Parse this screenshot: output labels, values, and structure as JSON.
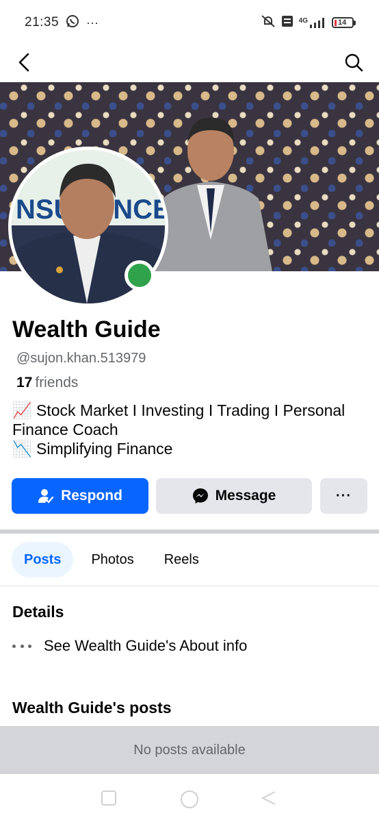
{
  "status_bar": {
    "time": "21:35",
    "more": "···",
    "network": "4G",
    "battery": "14"
  },
  "profile": {
    "name": "Wealth Guide",
    "handle": "@sujon.khan.513979",
    "friends_count": "17",
    "friends_label": "friends",
    "bio": [
      "📈 Stock Market I Investing I Trading I Personal Finance Coach",
      "📉 Simplifying Finance"
    ]
  },
  "actions": {
    "respond": "Respond",
    "message": "Message",
    "more": "···"
  },
  "tabs": [
    {
      "label": "Posts",
      "active": true
    },
    {
      "label": "Photos",
      "active": false
    },
    {
      "label": "Reels",
      "active": false
    }
  ],
  "details": {
    "title": "Details",
    "about_link": "See Wealth Guide's About info"
  },
  "posts": {
    "title": "Wealth Guide's posts",
    "empty_text": "No posts available"
  },
  "colors": {
    "primary": "#0866ff",
    "online": "#31a24c",
    "secondary_bg": "#e4e6eb",
    "secondary_text": "#65676b"
  }
}
